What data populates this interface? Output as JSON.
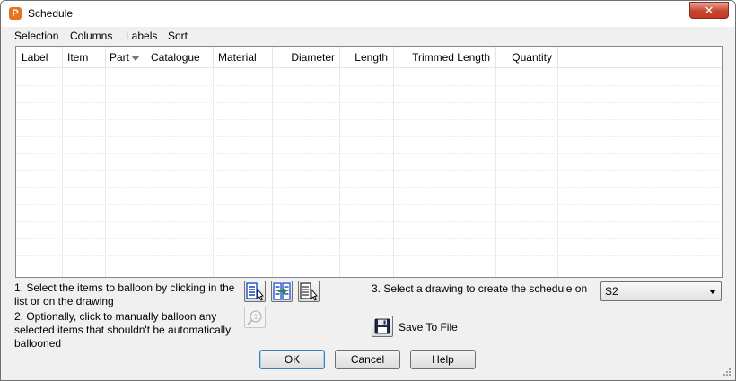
{
  "window": {
    "title": "Schedule",
    "app_icon_letter": "P",
    "close_glyph": "✕"
  },
  "menu": [
    {
      "label": "Selection"
    },
    {
      "label": "Columns"
    },
    {
      "label": "Labels"
    },
    {
      "label": "Sort"
    }
  ],
  "table": {
    "columns": [
      {
        "label": "Label"
      },
      {
        "label": "Item"
      },
      {
        "label": "Part",
        "sorted": "descending"
      },
      {
        "label": "Catalogue"
      },
      {
        "label": "Material"
      },
      {
        "label": "Diameter"
      },
      {
        "label": "Length"
      },
      {
        "label": "Trimmed Length"
      },
      {
        "label": "Quantity"
      }
    ],
    "rows": []
  },
  "instructions": {
    "step1_line1": "1. Select the items to balloon by clicking in the",
    "step1_line2": "list or on the drawing",
    "step2_line1": "2. Optionally, click to manually balloon any",
    "step2_line2": "selected items that shouldn't be automatically",
    "step2_line3": "ballooned",
    "step3": "3. Select a drawing to create the schedule on"
  },
  "drawing_select": {
    "value": "S2"
  },
  "save_to_file": {
    "label": "Save To File"
  },
  "buttons": {
    "ok": "OK",
    "cancel": "Cancel",
    "help": "Help"
  },
  "colors": {
    "close_red": "#c7432d",
    "icon_orange": "#e8731e",
    "icon_blue": "#1f4fc8",
    "icon_green": "#1e8a3a"
  }
}
